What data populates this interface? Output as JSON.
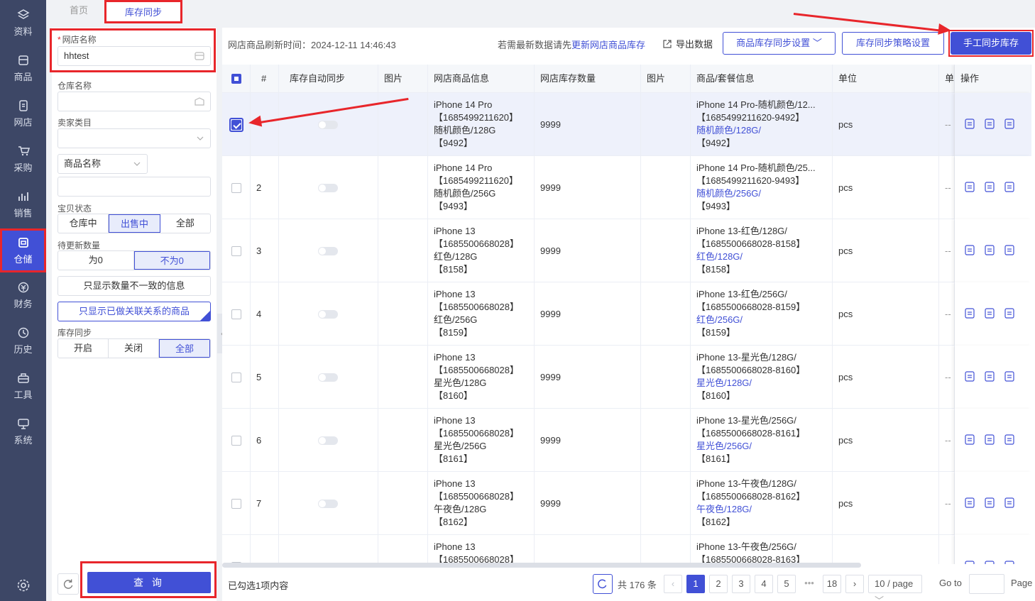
{
  "nav": {
    "items": [
      {
        "label": "资料",
        "icon": "layers-icon"
      },
      {
        "label": "商品",
        "icon": "box-icon"
      },
      {
        "label": "网店",
        "icon": "document-icon"
      },
      {
        "label": "采购",
        "icon": "cart-icon"
      },
      {
        "label": "销售",
        "icon": "chart-icon"
      },
      {
        "label": "仓储",
        "icon": "warehouse-icon"
      },
      {
        "label": "财务",
        "icon": "money-icon"
      },
      {
        "label": "历史",
        "icon": "clock-icon"
      },
      {
        "label": "工具",
        "icon": "toolbox-icon"
      },
      {
        "label": "系统",
        "icon": "monitor-icon"
      }
    ],
    "active_index": 5,
    "settings_icon": "gear-icon"
  },
  "tabs": {
    "home": "首页",
    "active": "库存同步"
  },
  "filter": {
    "shop_label": "网店名称",
    "shop_required": "*",
    "shop_value": "hhtest",
    "warehouse_label": "仓库名称",
    "warehouse_value": "",
    "seller_category_label": "卖家类目",
    "seller_category_value": "",
    "product_field_select": "商品名称",
    "product_field_value": "",
    "status_label": "宝贝状态",
    "status_options": [
      "仓库中",
      "出售中",
      "全部"
    ],
    "status_selected": 1,
    "pending_label": "待更新数量",
    "pending_options": [
      "为0",
      "不为0"
    ],
    "pending_selected": 1,
    "only_mismatch": "只显示数量不一致的信息",
    "only_linked": "只显示已做关联关系的商品",
    "sync_label": "库存同步",
    "sync_options": [
      "开启",
      "关闭",
      "全部"
    ],
    "sync_selected": 2,
    "query_button": "查 询"
  },
  "toolbar": {
    "refresh_time_label": "网店商品刷新时间：",
    "refresh_time": "2024-12-11 14:46:43",
    "hint_prefix": "若需最新数据请先",
    "hint_link": "更新网店商品库存",
    "export": "导出数据",
    "sync_settings": "商品库存同步设置",
    "strategy_settings": "库存同步策略设置",
    "manual_sync": "手工同步库存"
  },
  "table": {
    "columns": [
      "#",
      "库存自动同步",
      "图片",
      "网店商品信息",
      "网店库存数量",
      "图片",
      "商品/套餐信息",
      "单位",
      "单",
      "操作"
    ],
    "rows": [
      {
        "no": "",
        "checked": true,
        "shop_name": "iPhone 14 Pro",
        "shop_id": "【1685499211620】",
        "shop_spec": "随机颜色/128G",
        "shop_code": "【9492】",
        "qty": "9999",
        "goods_name": "iPhone 14 Pro-随机颜色/12...",
        "goods_id": "【1685499211620-9492】",
        "goods_spec": "随机颜色/128G/",
        "goods_code": "【9492】",
        "unit": "pcs",
        "extra": "--"
      },
      {
        "no": "2",
        "checked": false,
        "shop_name": "iPhone 14 Pro",
        "shop_id": "【1685499211620】",
        "shop_spec": "随机颜色/256G",
        "shop_code": "【9493】",
        "qty": "9999",
        "goods_name": "iPhone 14 Pro-随机颜色/25...",
        "goods_id": "【1685499211620-9493】",
        "goods_spec": "随机颜色/256G/",
        "goods_code": "【9493】",
        "unit": "pcs",
        "extra": "--"
      },
      {
        "no": "3",
        "checked": false,
        "shop_name": "iPhone 13",
        "shop_id": "【1685500668028】",
        "shop_spec": "红色/128G",
        "shop_code": "【8158】",
        "qty": "9999",
        "goods_name": "iPhone 13-红色/128G/",
        "goods_id": "【1685500668028-8158】",
        "goods_spec": "红色/128G/",
        "goods_code": "【8158】",
        "unit": "pcs",
        "extra": "--"
      },
      {
        "no": "4",
        "checked": false,
        "shop_name": "iPhone 13",
        "shop_id": "【1685500668028】",
        "shop_spec": "红色/256G",
        "shop_code": "【8159】",
        "qty": "9999",
        "goods_name": "iPhone 13-红色/256G/",
        "goods_id": "【1685500668028-8159】",
        "goods_spec": "红色/256G/",
        "goods_code": "【8159】",
        "unit": "pcs",
        "extra": "--"
      },
      {
        "no": "5",
        "checked": false,
        "shop_name": "iPhone 13",
        "shop_id": "【1685500668028】",
        "shop_spec": "星光色/128G",
        "shop_code": "【8160】",
        "qty": "9999",
        "goods_name": "iPhone 13-星光色/128G/",
        "goods_id": "【1685500668028-8160】",
        "goods_spec": "星光色/128G/",
        "goods_code": "【8160】",
        "unit": "pcs",
        "extra": "--"
      },
      {
        "no": "6",
        "checked": false,
        "shop_name": "iPhone 13",
        "shop_id": "【1685500668028】",
        "shop_spec": "星光色/256G",
        "shop_code": "【8161】",
        "qty": "9999",
        "goods_name": "iPhone 13-星光色/256G/",
        "goods_id": "【1685500668028-8161】",
        "goods_spec": "星光色/256G/",
        "goods_code": "【8161】",
        "unit": "pcs",
        "extra": "--"
      },
      {
        "no": "7",
        "checked": false,
        "shop_name": "iPhone 13",
        "shop_id": "【1685500668028】",
        "shop_spec": "午夜色/128G",
        "shop_code": "【8162】",
        "qty": "9999",
        "goods_name": "iPhone 13-午夜色/128G/",
        "goods_id": "【1685500668028-8162】",
        "goods_spec": "午夜色/128G/",
        "goods_code": "【8162】",
        "unit": "pcs",
        "extra": "--"
      },
      {
        "no": "",
        "checked": false,
        "shop_name": "iPhone 13",
        "shop_id": "【1685500668028】",
        "shop_spec": "",
        "shop_code": "",
        "qty": "",
        "goods_name": "iPhone 13-午夜色/256G/",
        "goods_id": "【1685500668028-8163】",
        "goods_spec": "",
        "goods_code": "",
        "unit": "",
        "extra": ""
      }
    ]
  },
  "footer": {
    "selected_text": "已勾选1项内容",
    "total": "共 176 条",
    "pages": [
      "1",
      "2",
      "3",
      "4",
      "5",
      "•••",
      "18"
    ],
    "current_page": "1",
    "page_size": "10 / page",
    "goto_label": "Go to",
    "page_suffix": "Page"
  },
  "colors": {
    "accent": "#4150d6",
    "highlight": "#e8262b",
    "nav_bg": "#3d4766"
  }
}
